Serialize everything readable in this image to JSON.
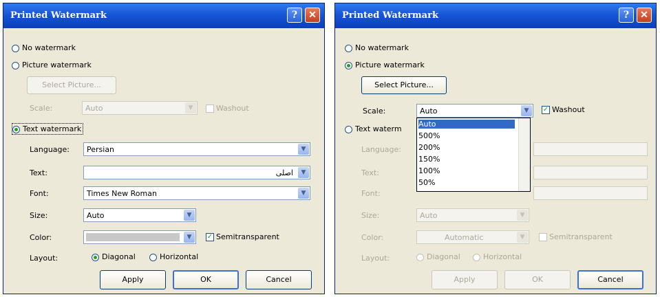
{
  "left_dialog": {
    "title": "Printed Watermark",
    "help_label": "?",
    "close_label": "✕",
    "no_watermark": "No watermark",
    "picture_watermark": "Picture watermark",
    "select_picture": "Select Picture...",
    "scale_label": "Scale:",
    "scale_value": "Auto",
    "washout": "Washout",
    "text_watermark": "Text watermark",
    "language_label": "Language:",
    "language_value": "Persian",
    "text_label": "Text:",
    "text_value": "اصلی",
    "font_label": "Font:",
    "font_value": "Times New Roman",
    "size_label": "Size:",
    "size_value": "Auto",
    "color_label": "Color:",
    "semitransparent": "Semitransparent",
    "layout_label": "Layout:",
    "diagonal": "Diagonal",
    "horizontal": "Horizontal",
    "apply": "Apply",
    "ok": "OK",
    "cancel": "Cancel"
  },
  "right_dialog": {
    "title": "Printed Watermark",
    "help_label": "?",
    "close_label": "✕",
    "no_watermark": "No watermark",
    "picture_watermark": "Picture watermark",
    "select_picture": "Select Picture...",
    "scale_label": "Scale:",
    "scale_value": "Auto",
    "washout": "Washout",
    "text_watermark": "Text waterm",
    "language_label": "Language:",
    "text_label": "Text:",
    "font_label": "Font:",
    "size_label": "Size:",
    "size_value": "Auto",
    "color_label": "Color:",
    "color_value": "Automatic",
    "semitransparent": "Semitransparent",
    "layout_label": "Layout:",
    "diagonal": "Diagonal",
    "horizontal": "Horizontal",
    "apply": "Apply",
    "ok": "OK",
    "cancel": "Cancel",
    "scale_options": [
      "Auto",
      "500%",
      "200%",
      "150%",
      "100%",
      "50%"
    ]
  },
  "colors": {
    "title_blue": "#1656d6",
    "dialog_bg": "#ece9d8",
    "selection": "#316ac5"
  }
}
